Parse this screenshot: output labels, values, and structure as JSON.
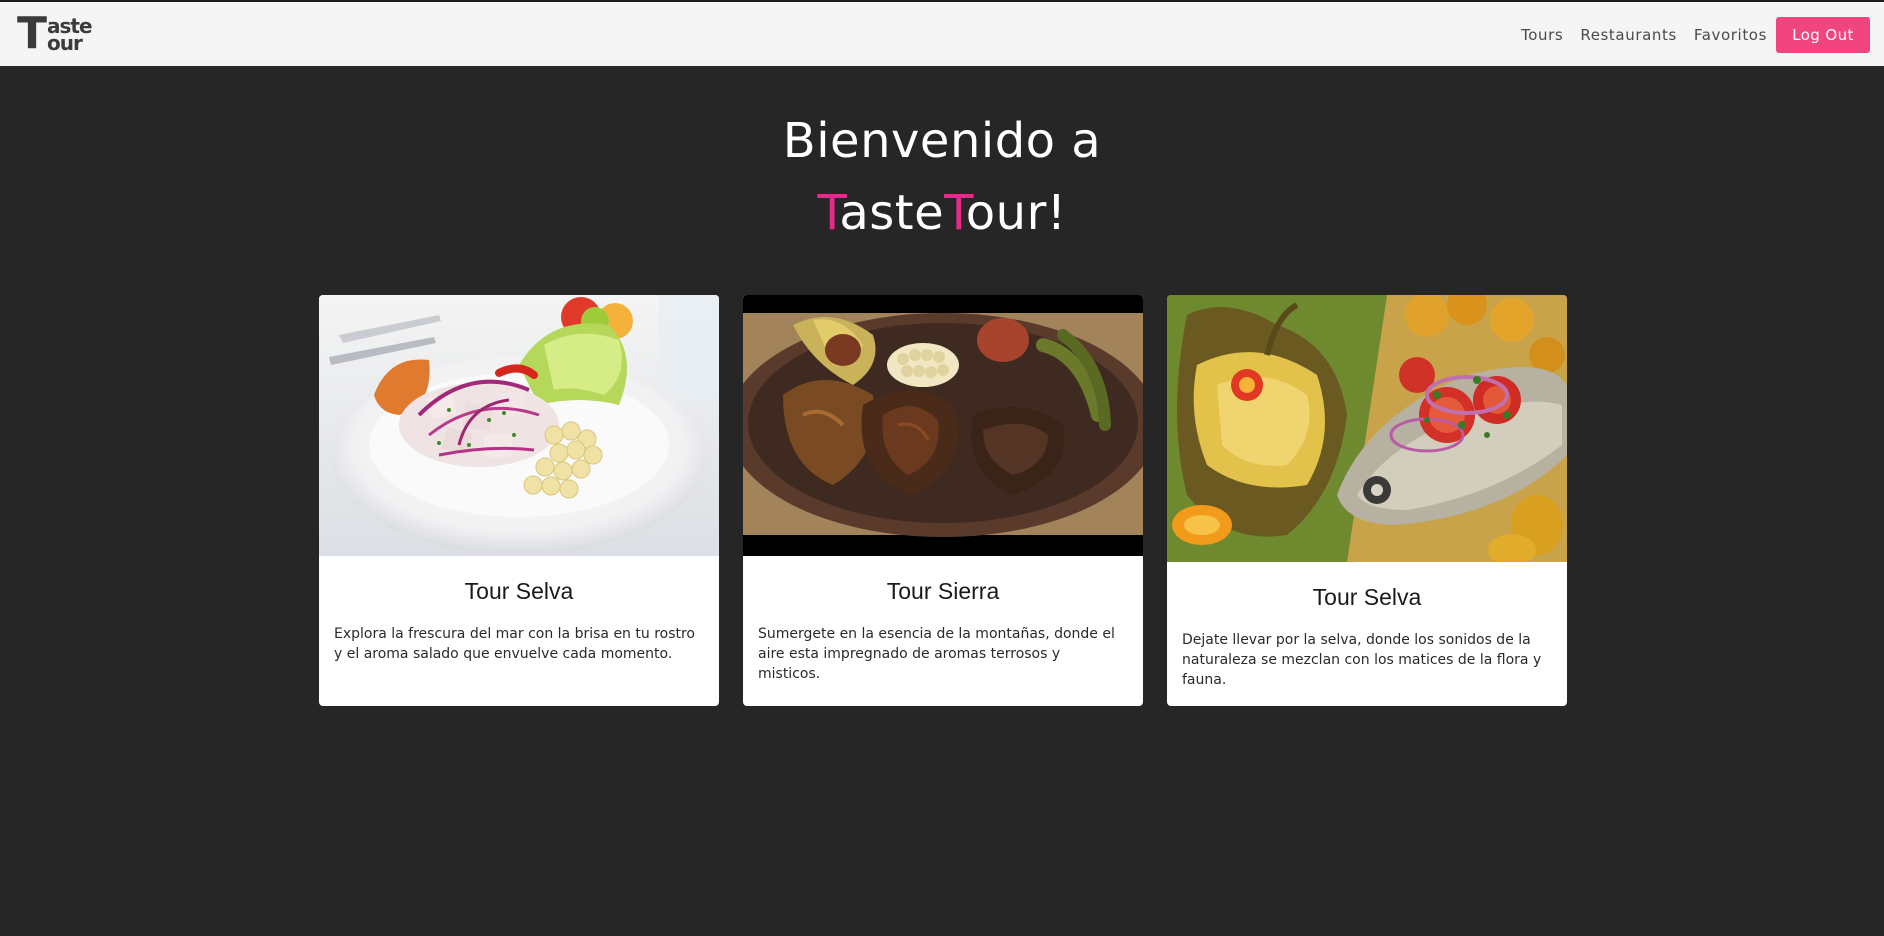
{
  "navbar": {
    "logo": {
      "big_letter": "T",
      "top_text": "aste",
      "bottom_text": "our"
    },
    "links": [
      "Tours",
      "Restaurants",
      "Favoritos"
    ],
    "logout_label": "Log Out"
  },
  "hero": {
    "line1": "Bienvenido a",
    "line2_parts": [
      "T",
      "aste",
      "T",
      "our!"
    ]
  },
  "cards": [
    {
      "title": "Tour Selva",
      "description": "Explora la frescura del mar con la brisa en tu rostro y el aroma salado que envuelve cada momento."
    },
    {
      "title": "Tour Sierra",
      "description": "Sumergete en la esencia de la montañas, donde el aire esta impregnado de aromas terrosos y misticos."
    },
    {
      "title": "Tour Selva",
      "description": "Dejate llevar por la selva, donde los sonidos de la naturaleza se mezclan con los matices de la flora y fauna."
    }
  ],
  "colors": {
    "background": "#262626",
    "navbar": "#f5f5f5",
    "accent_pink": "#e8288d",
    "logout_button": "#f0457f"
  }
}
